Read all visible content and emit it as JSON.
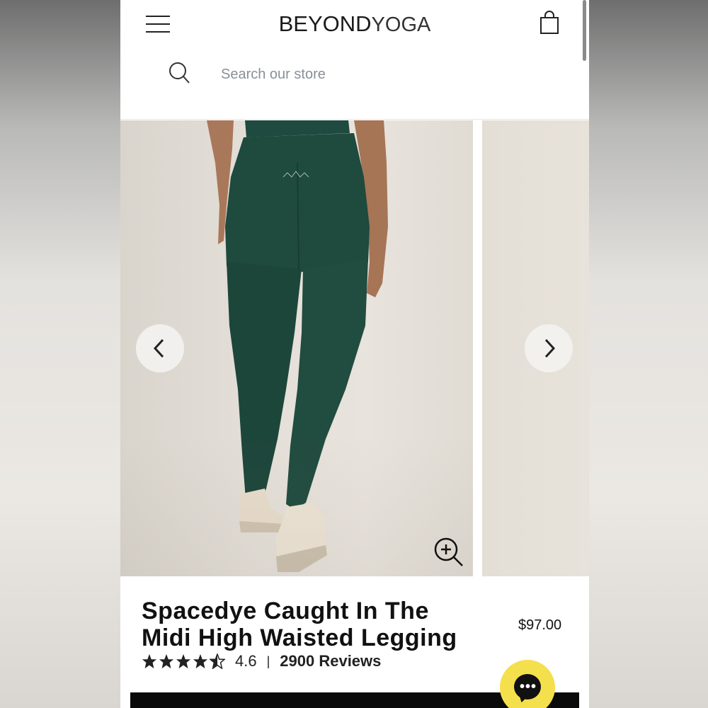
{
  "header": {
    "logo_bold": "BEYOND",
    "logo_light": "YOGA",
    "search_placeholder": "Search our store"
  },
  "gallery": {
    "prev_icon": "chevron-left-icon",
    "next_icon": "chevron-right-icon",
    "zoom_icon": "zoom-in-icon"
  },
  "product": {
    "title_line1": "Spacedye Caught In The",
    "title_line2": "Midi High Waisted Legging",
    "price": "$97.00",
    "rating_value": "4.6",
    "rating_fraction": 0.92,
    "separator": "|",
    "reviews": "2900 Reviews"
  },
  "colors": {
    "legging_green": "#1f4a3e",
    "chat_yellow": "#f4e04d",
    "text": "#111111"
  },
  "chat": {
    "icon": "chat-bubble-icon",
    "dots": "•••"
  }
}
